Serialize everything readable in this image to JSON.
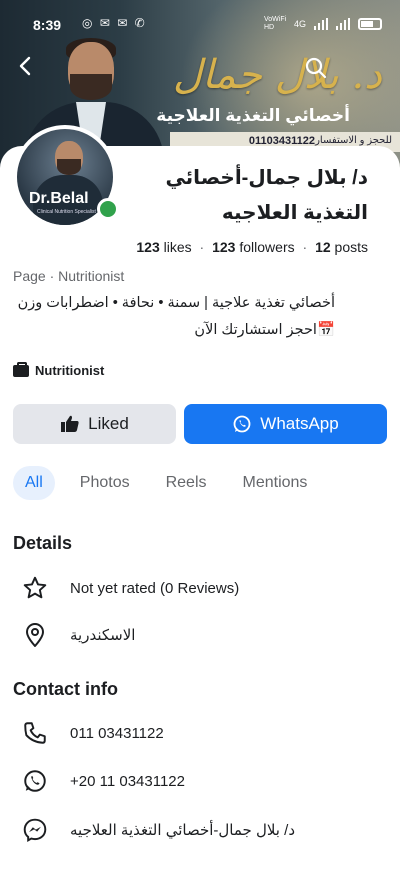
{
  "status_bar": {
    "time": "8:39",
    "notifications": "◎ ✉ ✉ ✆",
    "network": "4G",
    "volte": "VoWiFi HD"
  },
  "cover": {
    "logo_text": "د. بلال جمال",
    "subtitle": "أخصائي التغذية العلاجية",
    "phone_label": "للحجز و الاستفسار",
    "phone": "01103431122"
  },
  "profile": {
    "avatar_name": "Dr.Belal",
    "avatar_sub": "Clinical Nutrition Specialist",
    "name": "د/ بلال جمال-أخصائي التغذية العلاجيه",
    "likes_count": "123",
    "likes_label": "likes",
    "followers_count": "123",
    "followers_label": "followers",
    "posts_count": "12",
    "posts_label": "posts",
    "category": "Page · Nutritionist",
    "bio_line1": "أخصائي تغذية علاجية | سمنة • نحافة • اضطرابات وزن",
    "bio_line2": "📅احجز استشارتك الآن",
    "tag": "Nutritionist"
  },
  "actions": {
    "liked_label": "Liked",
    "whatsapp_label": "WhatsApp"
  },
  "tabs": [
    {
      "label": "All",
      "active": true
    },
    {
      "label": "Photos",
      "active": false
    },
    {
      "label": "Reels",
      "active": false
    },
    {
      "label": "Mentions",
      "active": false
    }
  ],
  "details": {
    "title": "Details",
    "rating": "Not yet rated (0 Reviews)",
    "location": "الاسكندرية"
  },
  "contact": {
    "title": "Contact info",
    "phone": "011 03431122",
    "whatsapp": "+20 11 03431122",
    "messenger": "د/ بلال جمال-أخصائي التغذية العلاجيه"
  },
  "colors": {
    "accent": "#1877f2",
    "online": "#31a24c",
    "secondary_text": "#65676b",
    "button_grey": "#e4e6eb"
  }
}
